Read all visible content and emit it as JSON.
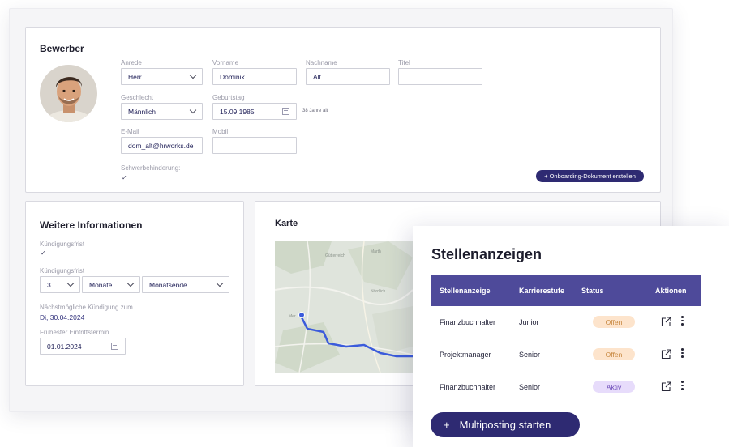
{
  "bewerber": {
    "title": "Bewerber",
    "anrede_label": "Anrede",
    "anrede_value": "Herr",
    "vorname_label": "Vorname",
    "vorname_value": "Dominik",
    "nachname_label": "Nachname",
    "nachname_value": "Alt",
    "titel_label": "Titel",
    "titel_value": "",
    "geschlecht_label": "Geschlecht",
    "geschlecht_value": "Männlich",
    "geburtstag_label": "Geburtstag",
    "geburtstag_value": "15.09.1985",
    "age_text": "38 Jahre alt",
    "email_label": "E-Mail",
    "email_value": "dom_alt@hrworks.de",
    "mobil_label": "Mobil",
    "mobil_value": "",
    "schwerbehinderung_label": "Schwerbehinderung:",
    "checkmark": "✓",
    "onboarding_button": "+  Onboarding-Dokument erstellen"
  },
  "weitere": {
    "title": "Weitere Informationen",
    "kuendigungsfrist_label_1": "Kündigungsfrist",
    "checkmark": "✓",
    "kuendigungsfrist_label_2": "Kündigungsfrist",
    "frist_number": "3",
    "frist_unit": "Monate",
    "frist_end": "Monatsende",
    "naechst_label": "Nächstmögliche Kündigung zum",
    "naechst_value": "Di, 30.04.2024",
    "eintritt_label": "Frühester Eintrittstermin",
    "eintritt_value": "01.01.2024"
  },
  "karte": {
    "title": "Karte",
    "map_labels": [
      "Gütterreich",
      "Marth",
      "Nördlich",
      "Mer"
    ]
  },
  "stellenanzeigen": {
    "title": "Stellenanzeigen",
    "columns": [
      "Stellenanzeige",
      "Karrierestufe",
      "Status",
      "Aktionen"
    ],
    "rows": [
      {
        "stelle": "Finanzbuchhalter",
        "stufe": "Junior",
        "status": "Offen"
      },
      {
        "stelle": "Projektmanager",
        "stufe": "Senior",
        "status": "Offen"
      },
      {
        "stelle": "Finanzbuchhalter",
        "stufe": "Senior",
        "status": "Aktiv"
      }
    ],
    "multiposting_plus": "+",
    "multiposting_label": "Multiposting starten"
  },
  "colors": {
    "accent": "#2e2a72",
    "table_header": "#4e4a9a",
    "status_offen_bg": "#fde4cc",
    "status_aktiv_bg": "#e7dcfb",
    "route": "#3b5bdb"
  },
  "icons": [
    "chevron-down-icon",
    "calendar-icon",
    "external-link-icon",
    "more-vertical-icon",
    "map-pin-icon"
  ]
}
